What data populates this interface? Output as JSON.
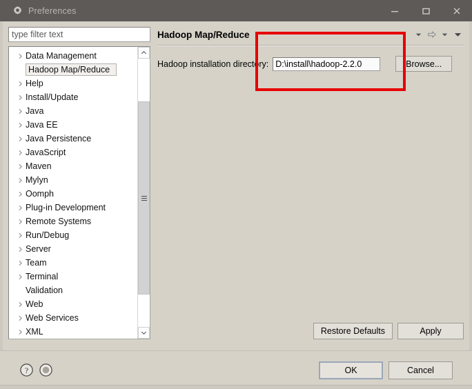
{
  "window": {
    "title": "Preferences",
    "icon": "gear-icon",
    "controls": {
      "minimize": "minimize-icon",
      "maximize": "maximize-icon",
      "close": "close-icon"
    }
  },
  "sidebar": {
    "filter": {
      "value": "",
      "placeholder": "type filter text"
    },
    "items": [
      {
        "label": "Data Management",
        "expandable": true,
        "selected": false
      },
      {
        "label": "Hadoop Map/Reduce",
        "expandable": false,
        "selected": true
      },
      {
        "label": "Help",
        "expandable": true,
        "selected": false
      },
      {
        "label": "Install/Update",
        "expandable": true,
        "selected": false
      },
      {
        "label": "Java",
        "expandable": true,
        "selected": false
      },
      {
        "label": "Java EE",
        "expandable": true,
        "selected": false
      },
      {
        "label": "Java Persistence",
        "expandable": true,
        "selected": false
      },
      {
        "label": "JavaScript",
        "expandable": true,
        "selected": false
      },
      {
        "label": "Maven",
        "expandable": true,
        "selected": false
      },
      {
        "label": "Mylyn",
        "expandable": true,
        "selected": false
      },
      {
        "label": "Oomph",
        "expandable": true,
        "selected": false
      },
      {
        "label": "Plug-in Development",
        "expandable": true,
        "selected": false
      },
      {
        "label": "Remote Systems",
        "expandable": true,
        "selected": false
      },
      {
        "label": "Run/Debug",
        "expandable": true,
        "selected": false
      },
      {
        "label": "Server",
        "expandable": true,
        "selected": false
      },
      {
        "label": "Team",
        "expandable": true,
        "selected": false
      },
      {
        "label": "Terminal",
        "expandable": true,
        "selected": false
      },
      {
        "label": "Validation",
        "expandable": false,
        "selected": false
      },
      {
        "label": "Web",
        "expandable": true,
        "selected": false
      },
      {
        "label": "Web Services",
        "expandable": true,
        "selected": false
      },
      {
        "label": "XML",
        "expandable": true,
        "selected": false
      }
    ],
    "scrollbar": {
      "up_icon": "chevron-up-icon",
      "down_icon": "chevron-down-icon",
      "thumb_top_pct": 16,
      "thumb_height_pct": 72
    }
  },
  "page": {
    "title": "Hadoop Map/Reduce",
    "header_icons": [
      "back-dropdown-icon",
      "forward-icon",
      "forward-dropdown-icon",
      "menu-dropdown-icon"
    ],
    "field": {
      "label": "Hadoop installation directory:",
      "value": "D:\\install\\hadoop-2.2.0",
      "placeholder": ""
    },
    "browse_label": "Browse...",
    "restore_defaults_label": "Restore Defaults",
    "apply_label": "Apply"
  },
  "footer": {
    "help_icon": "help-question-icon",
    "secondary_icon": "circle-icon",
    "ok_label": "OK",
    "cancel_label": "Cancel"
  },
  "annotation": {
    "type": "red-highlight-rectangle",
    "color": "#e60000"
  }
}
